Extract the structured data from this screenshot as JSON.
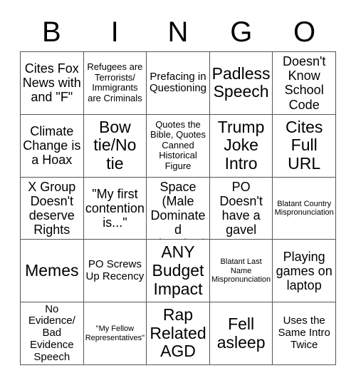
{
  "card": {
    "header_letters": [
      "B",
      "I",
      "N",
      "G",
      "O"
    ],
    "grid_border_color": "#555555",
    "text_color": "#000000",
    "background_color": "#ffffff",
    "rows": [
      [
        {
          "text": "Cites Fox News with and \"F\"",
          "size": "l"
        },
        {
          "text": "Refugees are Terrorists/ Immigrants are Criminals",
          "size": "s"
        },
        {
          "text": "Prefacing in Questioning",
          "size": "m"
        },
        {
          "text": "Padless Speech",
          "size": "xxl"
        },
        {
          "text": "Doesn't Know School Code",
          "size": "l"
        }
      ],
      [
        {
          "text": "Climate Change is a Hoax",
          "size": "l"
        },
        {
          "text": "Bow tie/No tie",
          "size": "xxl"
        },
        {
          "text": "Quotes the Bible, Quotes Canned Historical Figure",
          "size": "s"
        },
        {
          "text": "Trump Joke Intro",
          "size": "xxl"
        },
        {
          "text": "Cites Full URL",
          "size": "xxl"
        }
      ],
      [
        {
          "text": "X Group Doesn't deserve Rights",
          "size": "l"
        },
        {
          "text": "\"My first contention is...\"",
          "size": "l"
        },
        {
          "text": "Free Space (Male Dominated Chamber)",
          "size": "l"
        },
        {
          "text": "PO Doesn't have a gavel",
          "size": "l"
        },
        {
          "text": "Blatant Country Mispronunciation",
          "size": "xs"
        }
      ],
      [
        {
          "text": "Memes",
          "size": "xxl"
        },
        {
          "text": "PO Screws Up Recency",
          "size": "m"
        },
        {
          "text": "ANY Budget Impact",
          "size": "xxl"
        },
        {
          "text": "Blatant Last Name Mispronunciation",
          "size": "xs"
        },
        {
          "text": "Playing games on laptop",
          "size": "l"
        }
      ],
      [
        {
          "text": "No Evidence/ Bad Evidence Speech",
          "size": "m"
        },
        {
          "text": "\"My Fellow Representatives\"",
          "size": "xs"
        },
        {
          "text": "Rap Related AGD",
          "size": "xxl"
        },
        {
          "text": "Fell asleep",
          "size": "xxl"
        },
        {
          "text": "Uses the Same Intro Twice",
          "size": "m"
        }
      ]
    ]
  }
}
